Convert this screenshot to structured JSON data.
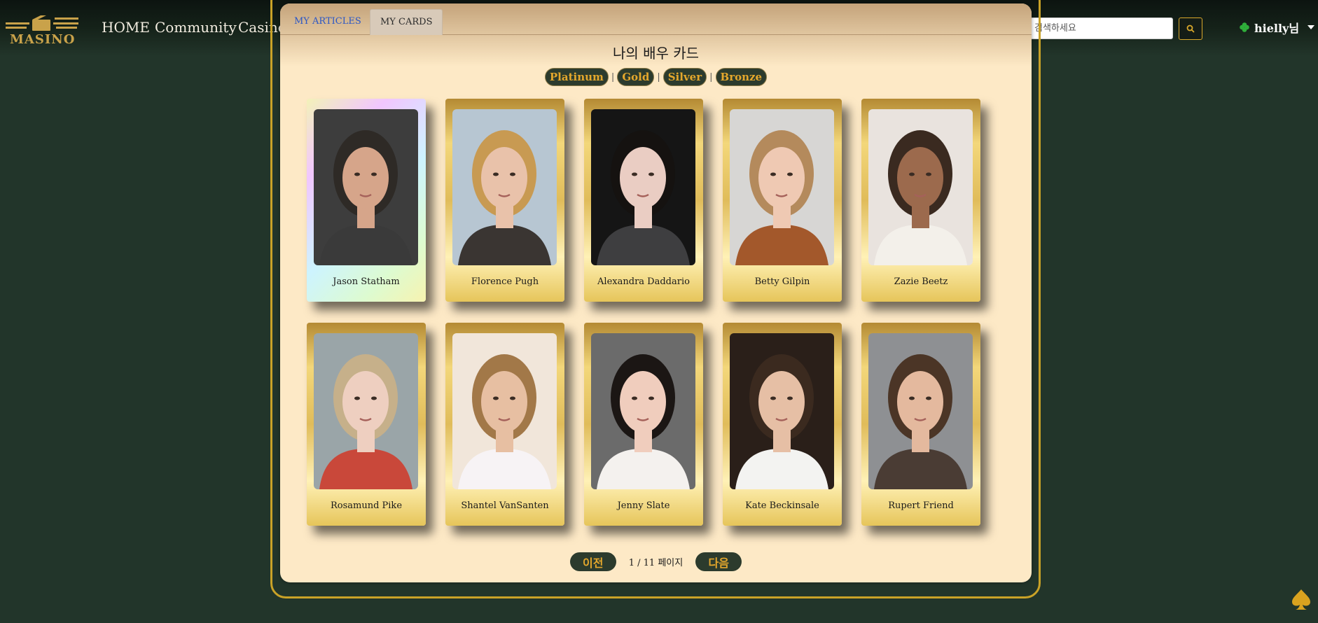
{
  "header": {
    "logo_text": "MASINO",
    "nav": [
      "HOME",
      "Community",
      "Casino"
    ],
    "search": {
      "placeholder": "영화를 검색하세요"
    },
    "user": {
      "name": "hielly님",
      "icon": "clover-icon"
    }
  },
  "tabs": [
    "MY ARTICLES",
    "MY CARDS"
  ],
  "active_tab": "MY CARDS",
  "page_title": "나의 배우 카드",
  "filters": [
    "Platinum",
    "Gold",
    "Silver",
    "Bronze"
  ],
  "cards": [
    {
      "name": "Jason Statham",
      "tier": "platinum",
      "bg": "#3d3d3d",
      "skin": "#d6a58a",
      "hair": "#2e2a26",
      "shirt": "#3a3a3a"
    },
    {
      "name": "Florence Pugh",
      "tier": "gold",
      "bg": "#b7c6d2",
      "skin": "#e9c2aa",
      "hair": "#c89a52",
      "shirt": "#3a3532"
    },
    {
      "name": "Alexandra Daddario",
      "tier": "gold",
      "bg": "#151515",
      "skin": "#eacdc3",
      "hair": "#151210",
      "shirt": "#3e3e40"
    },
    {
      "name": "Betty Gilpin",
      "tier": "gold",
      "bg": "#d7d6d4",
      "skin": "#efc9b3",
      "hair": "#b48a5c",
      "shirt": "#a3582b"
    },
    {
      "name": "Zazie Beetz",
      "tier": "gold",
      "bg": "#e9e3de",
      "skin": "#9c6a4d",
      "hair": "#3a2a20",
      "shirt": "#f3f0ea"
    },
    {
      "name": "Rosamund Pike",
      "tier": "gold",
      "bg": "#9aa5a8",
      "skin": "#eecfc0",
      "hair": "#c6b08a",
      "shirt": "#c9483a"
    },
    {
      "name": "Shantel VanSanten",
      "tier": "gold",
      "bg": "#f1e6da",
      "skin": "#e7bfa2",
      "hair": "#a27848",
      "shirt": "#f7f3f5"
    },
    {
      "name": "Jenny Slate",
      "tier": "gold",
      "bg": "#6b6b6b",
      "skin": "#f0cdbd",
      "hair": "#1b1614",
      "shirt": "#f4f1ee"
    },
    {
      "name": "Kate Beckinsale",
      "tier": "gold",
      "bg": "#2a1f19",
      "skin": "#e6bfa5",
      "hair": "#3b2a1f",
      "shirt": "#f3f3f1"
    },
    {
      "name": "Rupert Friend",
      "tier": "gold",
      "bg": "#8e9093",
      "skin": "#e4b99e",
      "hair": "#4b3526",
      "shirt": "#4a3c34"
    }
  ],
  "pager": {
    "prev": "이전",
    "next": "다음",
    "info": "1 / 11 페이지"
  }
}
